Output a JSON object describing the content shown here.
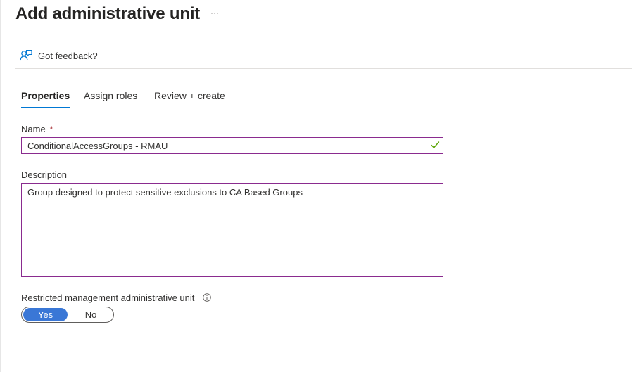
{
  "page": {
    "title": "Add administrative unit",
    "more_label": "···"
  },
  "feedback": {
    "label": "Got feedback?",
    "icon": "feedback-person-icon"
  },
  "tabs": [
    {
      "label": "Properties",
      "active": true
    },
    {
      "label": "Assign roles",
      "active": false
    },
    {
      "label": "Review + create",
      "active": false
    }
  ],
  "form": {
    "name": {
      "label": "Name",
      "required_mark": "*",
      "value": "ConditionalAccessGroups - RMAU",
      "valid_icon": "checkmark-icon"
    },
    "description": {
      "label": "Description",
      "value": "Group designed to protect sensitive exclusions to CA Based Groups"
    },
    "restricted": {
      "label": "Restricted management administrative unit",
      "info_icon": "info-icon",
      "options": [
        "Yes",
        "No"
      ],
      "selected": "Yes"
    }
  },
  "colors": {
    "accent": "#0078d4",
    "toggle_selected": "#3a77d6",
    "input_border": "#8a2b8f",
    "valid_check": "#57a300",
    "required": "#a4262c"
  }
}
